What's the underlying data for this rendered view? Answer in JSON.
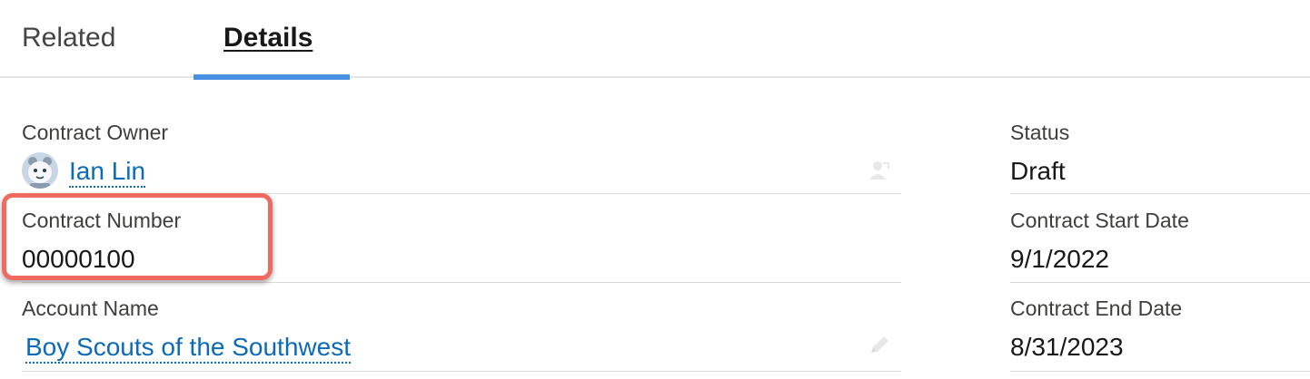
{
  "tabs": [
    {
      "label": "Related",
      "active": false
    },
    {
      "label": "Details",
      "active": true
    }
  ],
  "left_fields": {
    "owner": {
      "label": "Contract Owner",
      "value": "Ian Lin",
      "icon": "change-owner-icon"
    },
    "contract_number": {
      "label": "Contract Number",
      "value": "00000100"
    },
    "account_name": {
      "label": "Account Name",
      "value": "Boy Scouts of the Southwest",
      "icon": "pencil-icon"
    }
  },
  "right_fields": {
    "status": {
      "label": "Status",
      "value": "Draft"
    },
    "start_date": {
      "label": "Contract Start Date",
      "value": "9/1/2022"
    },
    "end_date": {
      "label": "Contract End Date",
      "value": "8/31/2023"
    }
  },
  "colors": {
    "link": "#0b6bb8",
    "active_tab_indicator": "#4a90e2",
    "highlight": "#f06a5f",
    "label": "#3e3e3c",
    "divider": "#dddbda"
  }
}
